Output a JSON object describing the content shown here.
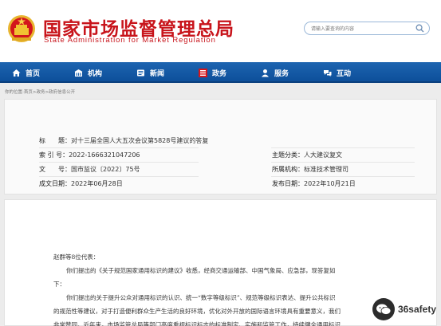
{
  "header": {
    "title": "国家市场监督管理总局",
    "subtitle": "State Administration for Market Regulation",
    "search_placeholder": "请输入要查询的内容"
  },
  "nav": {
    "items": [
      {
        "label": "首页",
        "icon": "home-icon"
      },
      {
        "label": "机构",
        "icon": "building-icon"
      },
      {
        "label": "新闻",
        "icon": "news-icon"
      },
      {
        "label": "政务",
        "icon": "affairs-icon"
      },
      {
        "label": "服务",
        "icon": "service-icon"
      },
      {
        "label": "互动",
        "icon": "interaction-icon"
      }
    ]
  },
  "breadcrumb": "你的位置:首页>政务>政府信息公开",
  "meta": {
    "title_label": "标　　题：",
    "title_value": "对十三届全国人大五次会议第5828号建议的答复",
    "index_label": "索 引 号：",
    "index_value": "2022-1666321047206",
    "category_label": "主题分类：",
    "category_value": "人大建议复文",
    "docno_label": "文　　号：",
    "docno_value": "国市监议〔2022〕75号",
    "dept_label": "所属机构：",
    "dept_value": "标准技术管理司",
    "created_label": "成文日期：",
    "created_value": "2022年06月28日",
    "published_label": "发布日期：",
    "published_value": "2022年10月21日"
  },
  "content": {
    "salutation": "赵群等8位代表：",
    "p1_line1": "你们提出的《关于规范国家通用标识的建议》收悉，经商交通运输部、中国气象局、应急部，现答复如",
    "p1_line2": "下：",
    "p2_line1": "你们提出的关于提升公众对通用标识的认识、统一“数字等级标识”、规范等级标识表达、提升公共标识",
    "p2_line2": "的规范性等建议，对于打造便利群众生产生活的良好环境，优化对外开放的国际语言环境具有重要意义，我们",
    "p2_line3": "非常赞同。近年来，市场监管总局等部门高度重视标识标志的标准制定、实施和监管工作，持续健全通用标识"
  },
  "watermark": {
    "text": "36safety"
  },
  "colors": {
    "brand_red": "#c8141b",
    "nav_blue": "#0d4f9a"
  }
}
